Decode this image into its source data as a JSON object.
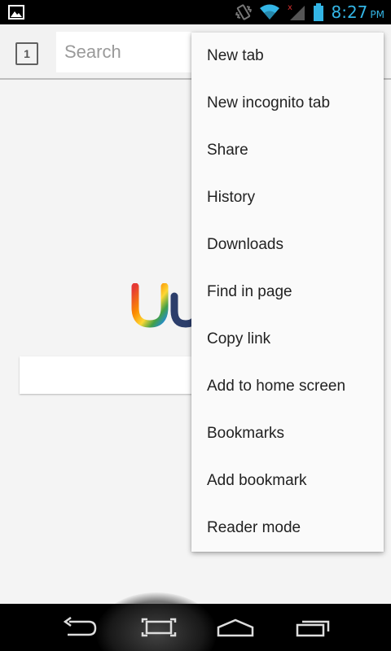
{
  "status_bar": {
    "time": "8:27",
    "ampm": "PM",
    "icons": [
      "gallery-notification-icon",
      "vibrate-icon",
      "wifi-icon",
      "signal-icon",
      "battery-icon"
    ],
    "accent_color": "#33b5e5"
  },
  "toolbar": {
    "tab_count": "1",
    "search_placeholder": "Search"
  },
  "menu": {
    "items": [
      {
        "label": "New tab"
      },
      {
        "label": "New incognito tab"
      },
      {
        "label": "Share"
      },
      {
        "label": "History"
      },
      {
        "label": "Downloads"
      },
      {
        "label": "Find in page"
      },
      {
        "label": "Copy link"
      },
      {
        "label": "Add to home screen"
      },
      {
        "label": "Bookmarks"
      },
      {
        "label": "Add bookmark"
      },
      {
        "label": "Reader mode"
      }
    ]
  },
  "nav_bar": {
    "buttons": [
      "back-icon",
      "screenshot-icon",
      "home-icon",
      "recents-icon"
    ]
  }
}
